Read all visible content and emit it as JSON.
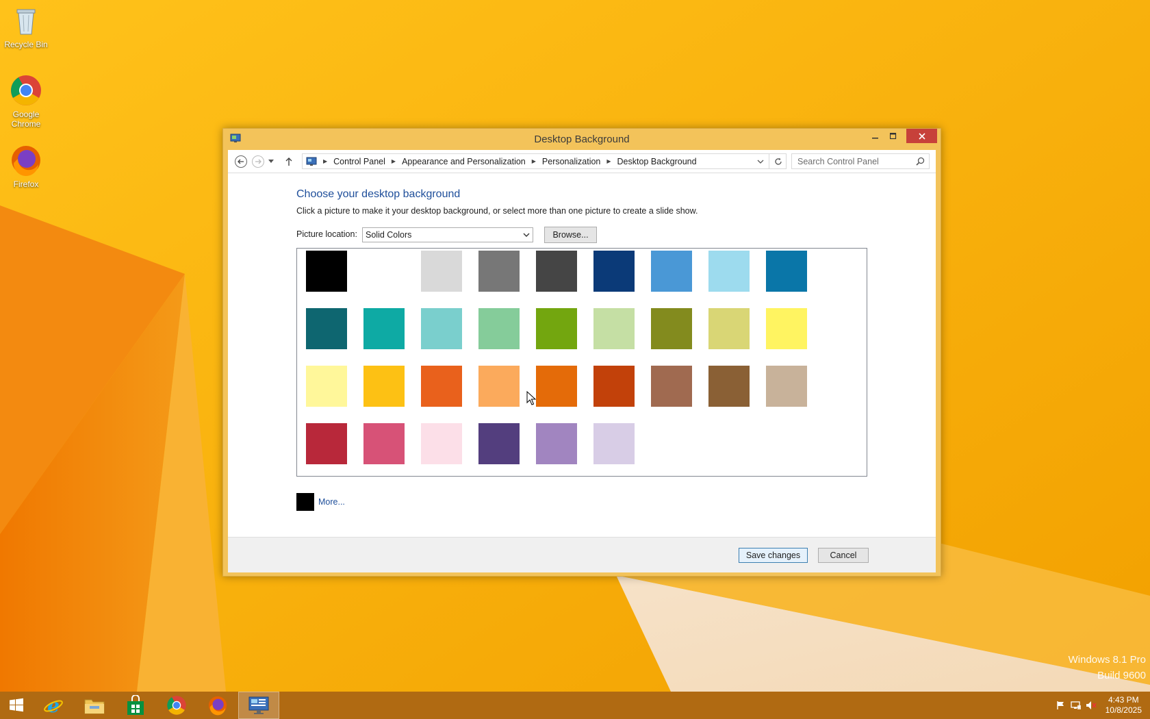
{
  "desktop": {
    "icons": [
      {
        "label": "Recycle Bin",
        "icon": "recycle-bin-icon"
      },
      {
        "label": "Google Chrome",
        "icon": "chrome-icon"
      },
      {
        "label": "Firefox",
        "icon": "firefox-icon"
      }
    ],
    "watermark": {
      "line1": "Windows 8.1 Pro",
      "line2": "Build 9600"
    }
  },
  "window": {
    "title": "Desktop Background",
    "breadcrumbs": [
      "Control Panel",
      "Appearance and Personalization",
      "Personalization",
      "Desktop Background"
    ],
    "search_placeholder": "Search Control Panel"
  },
  "content": {
    "heading": "Choose your desktop background",
    "subtext": "Click a picture to make it your desktop background, or select more than one picture to create a slide show.",
    "location_label": "Picture location:",
    "location_value": "Solid Colors",
    "browse_label": "Browse...",
    "more_label": "More...",
    "more_color": "#000000"
  },
  "swatches": [
    "#000000",
    "#ffffff",
    "#d9d9d9",
    "#777777",
    "#454545",
    "#0b3a78",
    "#4a98d6",
    "#9ddbee",
    "#0a76a8",
    "#0e6670",
    "#0eaaa4",
    "#7acfcd",
    "#85cc9a",
    "#73a60f",
    "#c5dfa4",
    "#838b1e",
    "#d9d675",
    "#fff461",
    "#fff79a",
    "#fdc114",
    "#e9611c",
    "#fbaa5c",
    "#e46b09",
    "#c2410a",
    "#a06a50",
    "#8a6035",
    "#c8b29a",
    "#b8283a",
    "#d75277",
    "#fcdfe8",
    "#533e7e",
    "#a185c0",
    "#d8cde6"
  ],
  "footer": {
    "save_label": "Save changes",
    "cancel_label": "Cancel"
  },
  "taskbar": {
    "apps": [
      "start-button",
      "internet-explorer",
      "file-explorer",
      "store",
      "chrome",
      "firefox",
      "control-panel"
    ],
    "clock_time": "4:43 PM",
    "clock_date": "10/8/2025"
  },
  "colors": {
    "wallpaper_accent": "#f6a800",
    "window_frame": "#f3c35a",
    "close_button": "#c7413a",
    "link": "#1e4e9a",
    "taskbar": "#b06a12"
  }
}
